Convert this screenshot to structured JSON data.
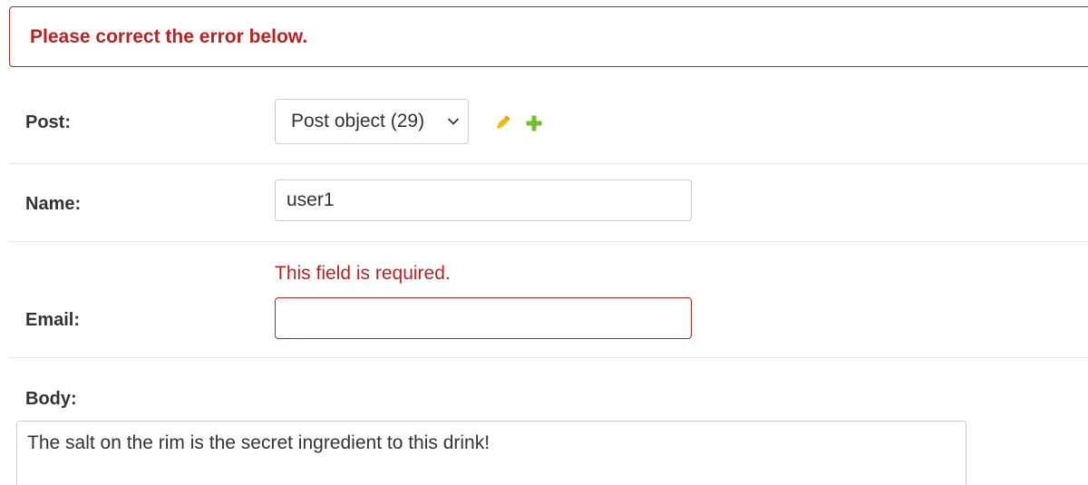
{
  "error_note": "Please correct the error below.",
  "fields": {
    "post": {
      "label": "Post:",
      "selected": "Post object (29)",
      "change_icon": "pencil-icon",
      "add_icon": "plus-icon"
    },
    "name": {
      "label": "Name:",
      "value": "user1"
    },
    "email": {
      "label": "Email:",
      "value": "",
      "error": "This field is required."
    },
    "body": {
      "label": "Body:",
      "value": "The salt on the rim is the secret ingredient to this drink!"
    }
  },
  "colors": {
    "error": "#ba2121",
    "change_icon": "#efb80b",
    "add_icon": "#70bf2b",
    "border": "#cccccc",
    "divider": "#e6e6e6"
  }
}
